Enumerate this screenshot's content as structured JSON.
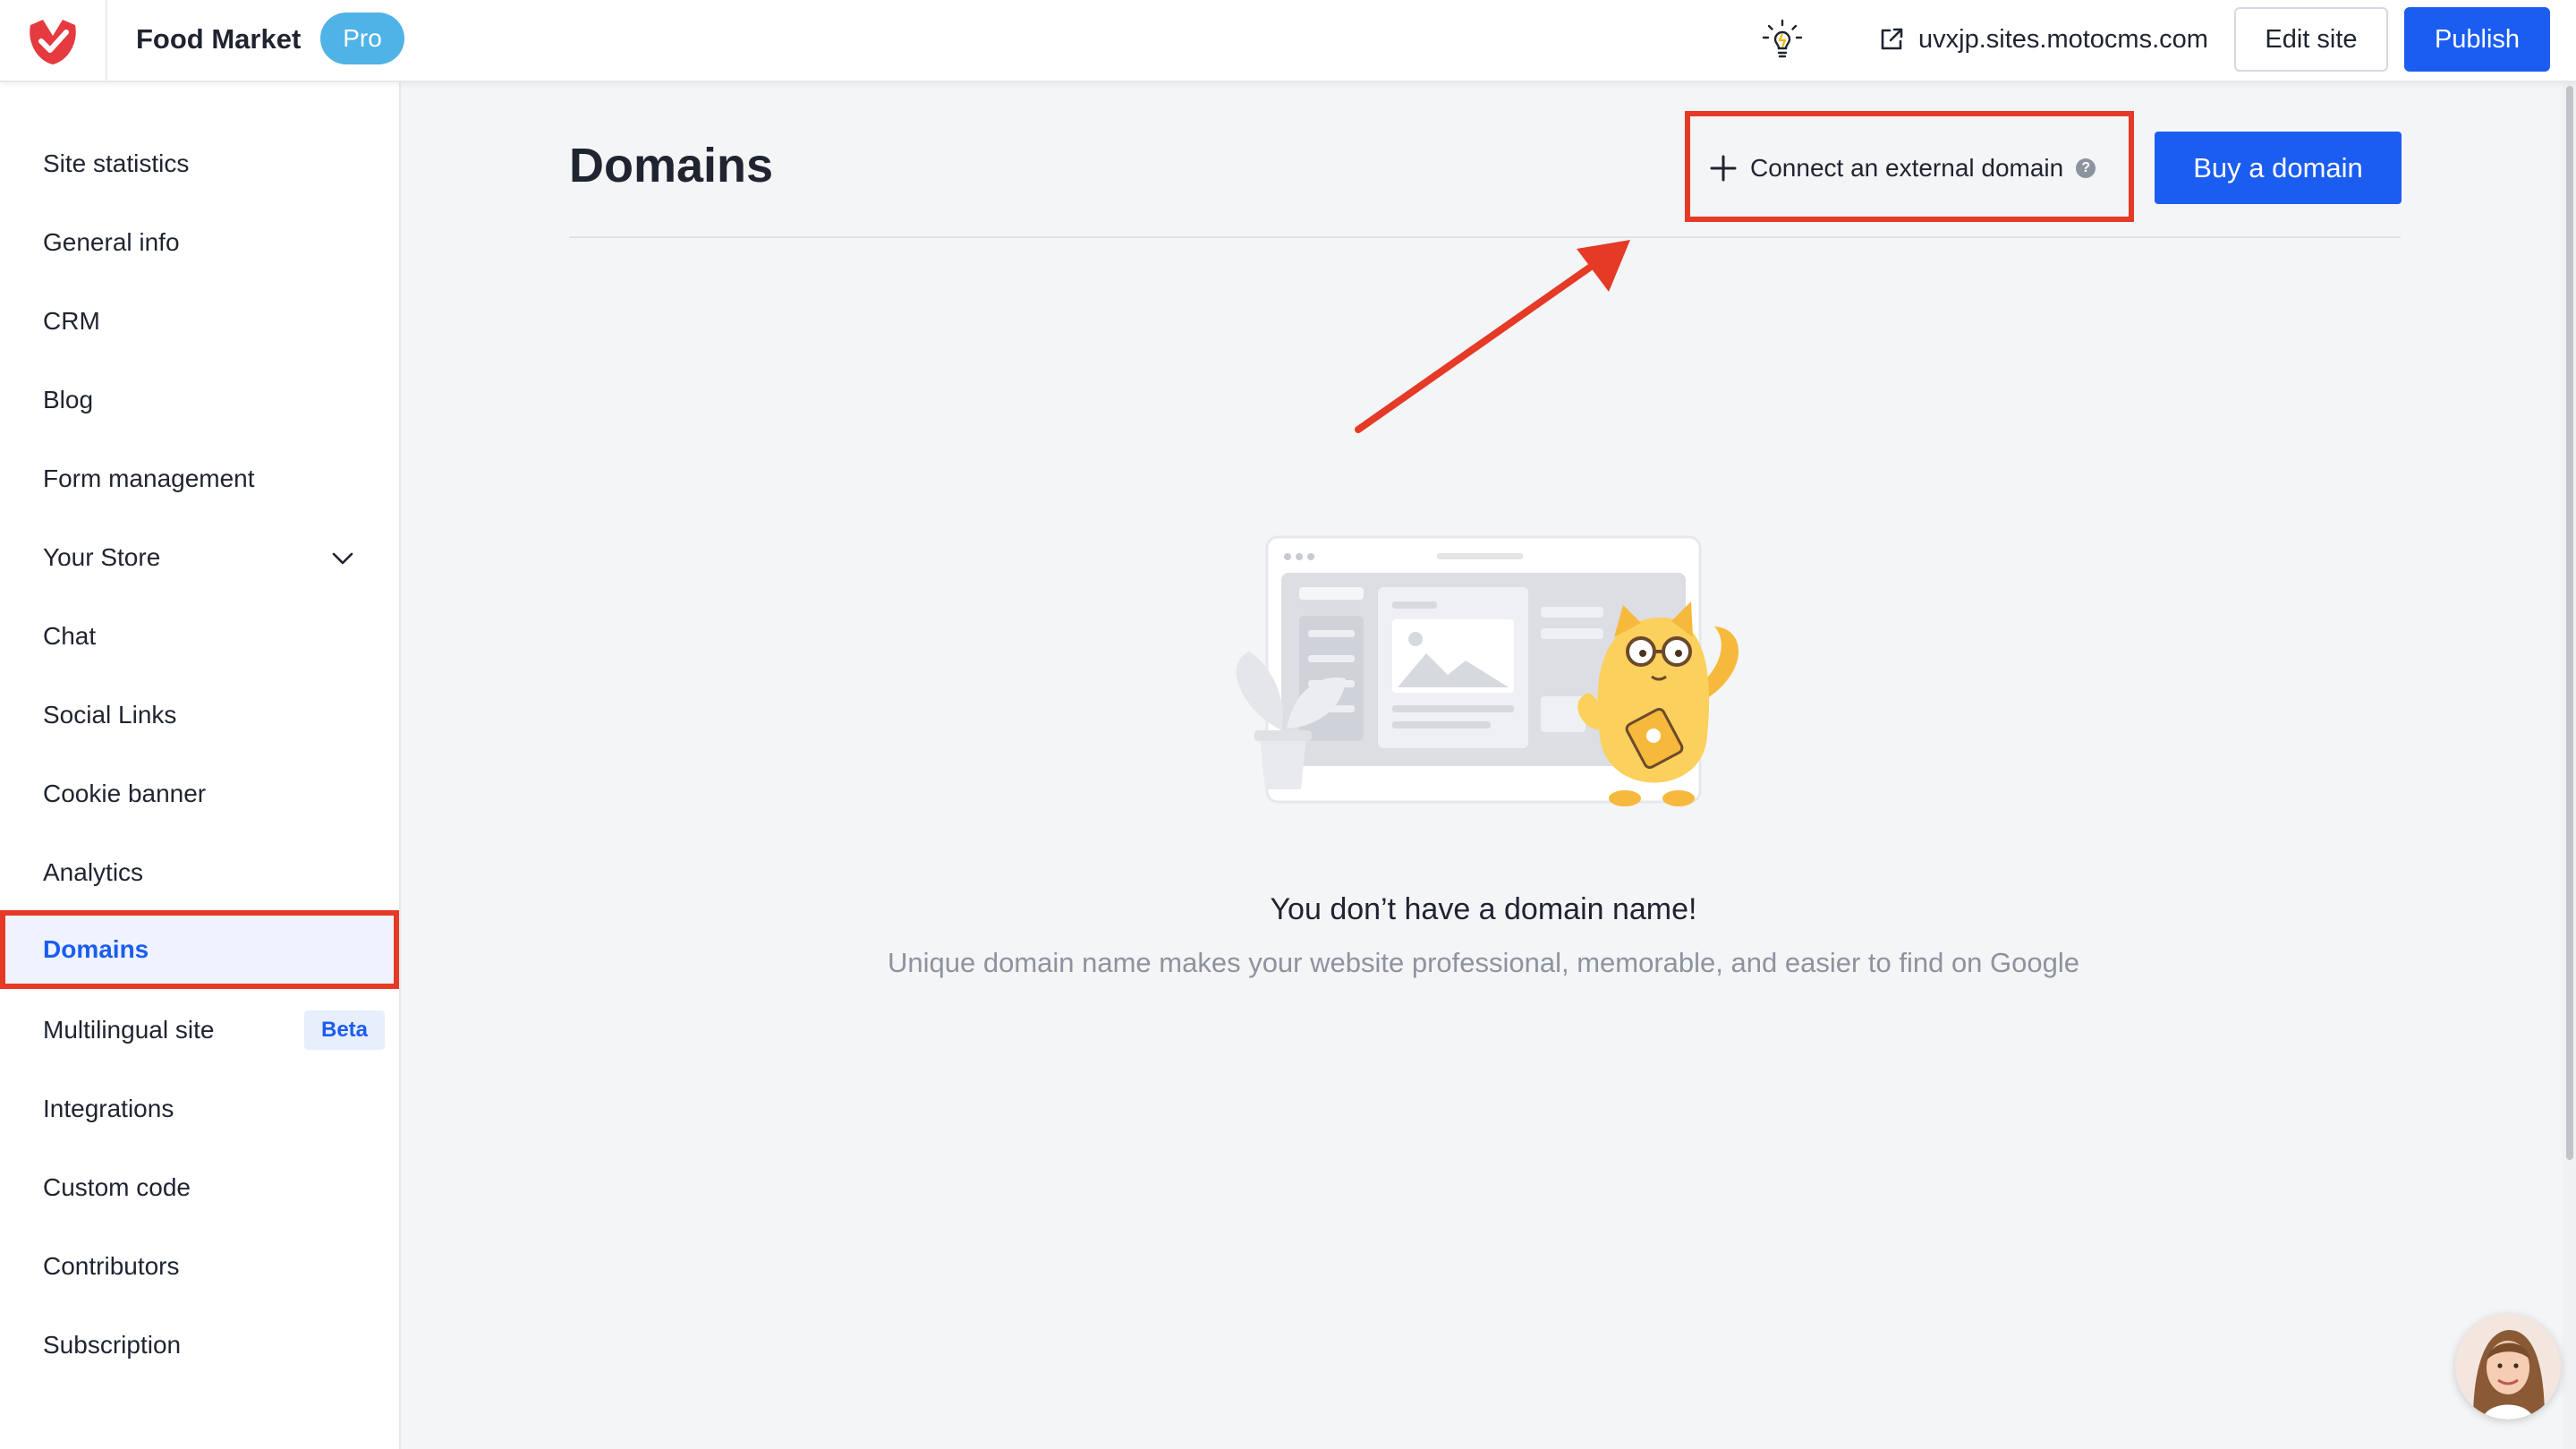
{
  "header": {
    "app_title": "Food Market",
    "plan_badge": "Pro",
    "site_url": "uvxjp.sites.motocms.com",
    "edit_label": "Edit site",
    "publish_label": "Publish"
  },
  "sidebar": {
    "items": [
      {
        "label": "Site statistics"
      },
      {
        "label": "General info"
      },
      {
        "label": "CRM"
      },
      {
        "label": "Blog"
      },
      {
        "label": "Form management"
      },
      {
        "label": "Your Store"
      },
      {
        "label": "Chat"
      },
      {
        "label": "Social Links"
      },
      {
        "label": "Cookie banner"
      },
      {
        "label": "Analytics"
      },
      {
        "label": "Domains"
      },
      {
        "label": "Multilingual site",
        "badge": "Beta"
      },
      {
        "label": "Integrations"
      },
      {
        "label": "Custom code"
      },
      {
        "label": "Contributors"
      },
      {
        "label": "Subscription"
      }
    ],
    "active": "Domains"
  },
  "main": {
    "title": "Domains",
    "connect_label": "Connect an external domain",
    "help_glyph": "?",
    "buy_label": "Buy a domain",
    "empty_title": "You don’t have a domain name!",
    "empty_subtitle": "Unique domain name makes your website professional, memorable, and easier to find on Google"
  },
  "icons": {
    "logo": "motocms-logo-icon",
    "bulb": "lightbulb-icon",
    "external": "external-link-icon",
    "chevron": "chevron-down-icon",
    "plus": "plus-icon",
    "help": "help-icon"
  },
  "colors": {
    "accent": "#1b5df1",
    "highlight": "#e53a26",
    "badge": "#4fb3e6"
  }
}
